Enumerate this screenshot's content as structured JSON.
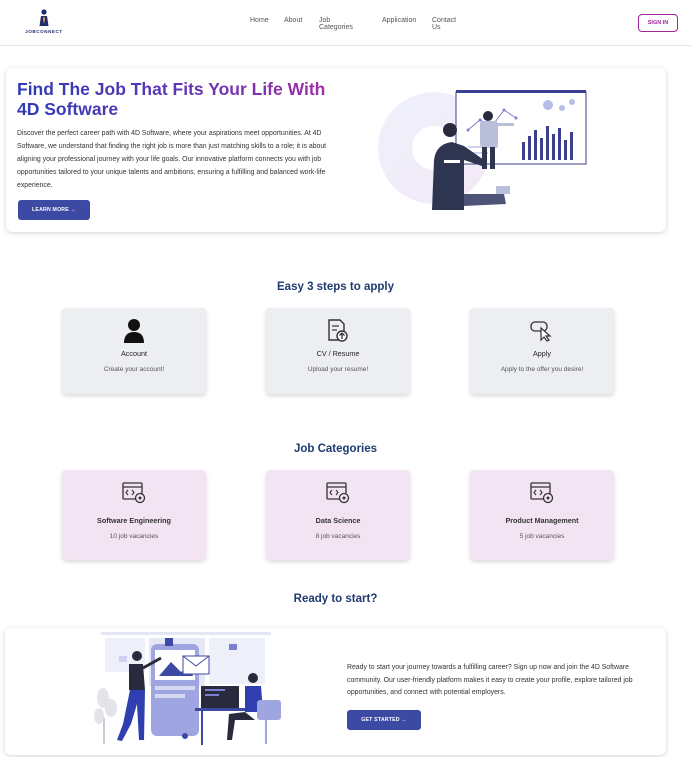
{
  "brand": {
    "logo_text": "JOBCONNECT"
  },
  "nav": {
    "links": [
      "Home",
      "About",
      "Job Categories",
      "Application",
      "Contact Us"
    ],
    "signin_label": "SIGN IN"
  },
  "hero": {
    "title": "Find The Job That Fits Your Life With 4D Software",
    "description": "Discover the perfect career path with 4D Software, where your aspirations meet opportunities. At 4D Software, we understand that finding the right job is more than just matching skills to a role; it is about aligning your professional journey with your life goals. Our innovative platform connects you with job opportunities tailored to your unique talents and ambitions, ensuring a fulfilling and balanced work-life experience.",
    "button_label": "LEARN MORE →"
  },
  "steps": {
    "title": "Easy 3 steps to apply",
    "items": [
      {
        "icon": "user-icon",
        "title": "Account",
        "subtitle": "Create your account!"
      },
      {
        "icon": "resume-upload-icon",
        "title": "CV / Resume",
        "subtitle": "Upload your resume!"
      },
      {
        "icon": "apply-cursor-icon",
        "title": "Apply",
        "subtitle": "Apply to the offer you desire!"
      }
    ]
  },
  "categories": {
    "title": "Job Categories",
    "items": [
      {
        "icon": "code-settings-icon",
        "title": "Software Engineering",
        "subtitle": "10 job vacancies"
      },
      {
        "icon": "code-settings-icon",
        "title": "Data Science",
        "subtitle": "8 job vacancies"
      },
      {
        "icon": "code-settings-icon",
        "title": "Product Management",
        "subtitle": "5 job vacancies"
      }
    ]
  },
  "ready": {
    "title": "Ready to start?",
    "text": "Ready to start your journey towards a fulfilling career? Sign up now and join the 4D Software community. Our user-friendly platform makes it easy to create your profile, explore tailored job opportunities, and connect with potential employers.",
    "button_label": "GET STARTED →"
  },
  "colors": {
    "primary_button": "#3d4aa3",
    "accent": "#a3249a",
    "heading": "#1f3a6e",
    "step_card_bg": "#eceef1",
    "category_card_bg": "#f3e4f3"
  }
}
